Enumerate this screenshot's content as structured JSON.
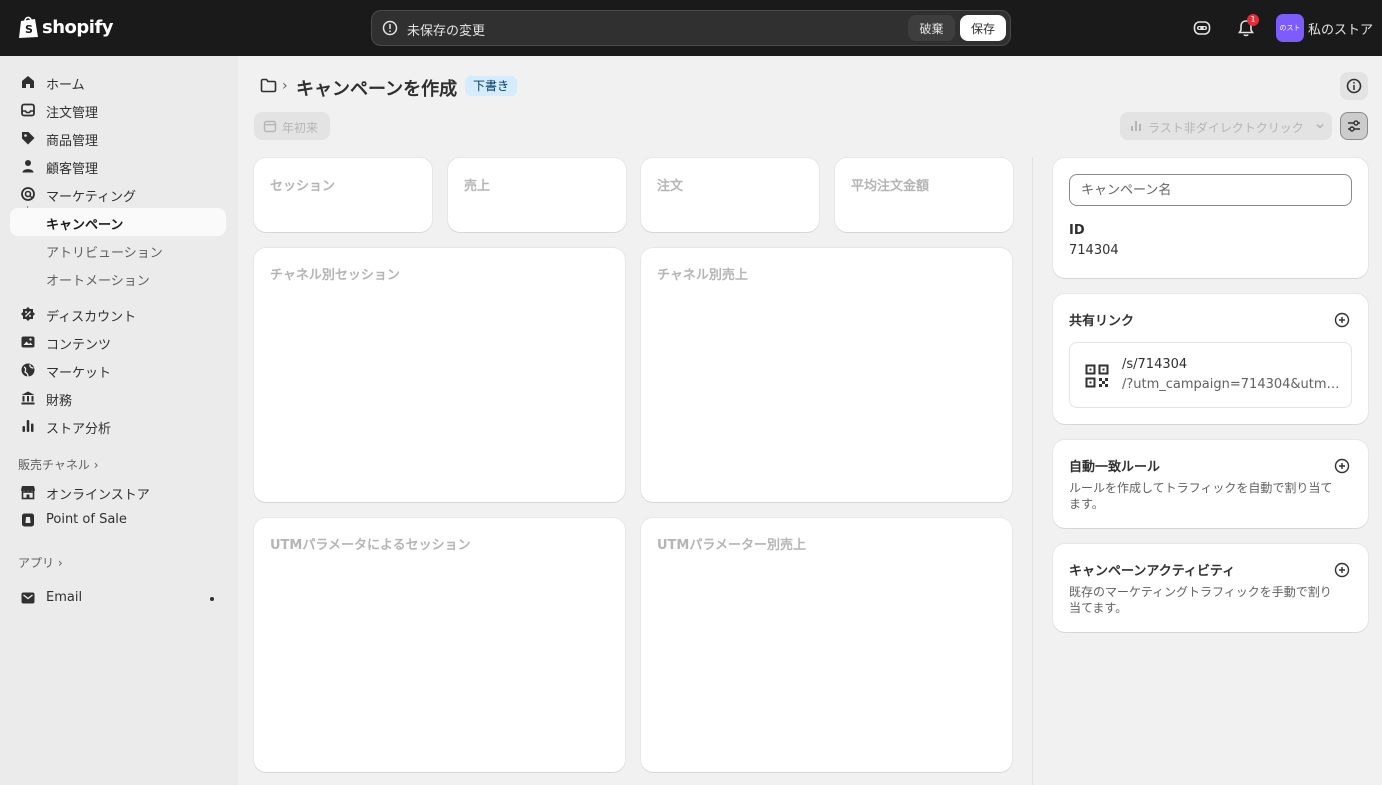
{
  "topbar": {
    "logo_text": "shopify",
    "unsaved_text": "未保存の変更",
    "discard_label": "破棄",
    "save_label": "保存",
    "notification_count": "1",
    "avatar_text": "のスト",
    "store_name": "私のストア"
  },
  "sidebar": {
    "items": [
      {
        "label": "ホーム",
        "icon": "home-icon"
      },
      {
        "label": "注文管理",
        "icon": "inbox-icon"
      },
      {
        "label": "商品管理",
        "icon": "tag-icon"
      },
      {
        "label": "顧客管理",
        "icon": "person-icon"
      },
      {
        "label": "マーケティング",
        "icon": "target-icon"
      },
      {
        "label": "キャンペーン"
      },
      {
        "label": "アトリビューション"
      },
      {
        "label": "オートメーション"
      },
      {
        "label": "ディスカウント",
        "icon": "discount-icon"
      },
      {
        "label": "コンテンツ",
        "icon": "image-icon"
      },
      {
        "label": "マーケット",
        "icon": "globe-icon"
      },
      {
        "label": "財務",
        "icon": "bank-icon"
      },
      {
        "label": "ストア分析",
        "icon": "bar-chart-icon"
      }
    ],
    "sales_channels_label": "販売チャネル",
    "channels": [
      {
        "label": "オンラインストア",
        "icon": "store-icon"
      },
      {
        "label": "Point of Sale",
        "icon": "pos-icon"
      }
    ],
    "apps_label": "アプリ",
    "apps": [
      {
        "label": "Email",
        "icon": "email-icon"
      }
    ]
  },
  "page": {
    "title": "キャンペーンを作成",
    "status_badge": "下書き",
    "date_range": "年初来",
    "attribution_model": "ラスト非ダイレクトクリック"
  },
  "metrics": {
    "sessions": "セッション",
    "sales": "売上",
    "orders": "注文",
    "aov": "平均注文金額"
  },
  "panels": {
    "sessions_by_channel": "チャネル別セッション",
    "sales_by_channel": "チャネル別売上",
    "sessions_by_utm": "UTMパラメータによるセッション",
    "sales_by_utm": "UTMパラメーター別売上"
  },
  "details": {
    "campaign_name_placeholder": "キャンペーン名",
    "id_label": "ID",
    "id_value": "714304"
  },
  "share_link": {
    "title": "共有リンク",
    "path": "/s/714304",
    "query": "/?utm_campaign=714304&utm_s..."
  },
  "auto_rules": {
    "title": "自動一致ルール",
    "description": "ルールを作成してトラフィックを自動で割り当てます。"
  },
  "activity": {
    "title": "キャンペーンアクティビティ",
    "description": "既存のマーケティングトラフィックを手動で割り当てます。"
  },
  "colors": {
    "topbar_bg": "#1a1a1a",
    "badge_bg": "#d5ebff",
    "avatar_bg": "#7c5cff",
    "notification_red": "#e22c38"
  }
}
